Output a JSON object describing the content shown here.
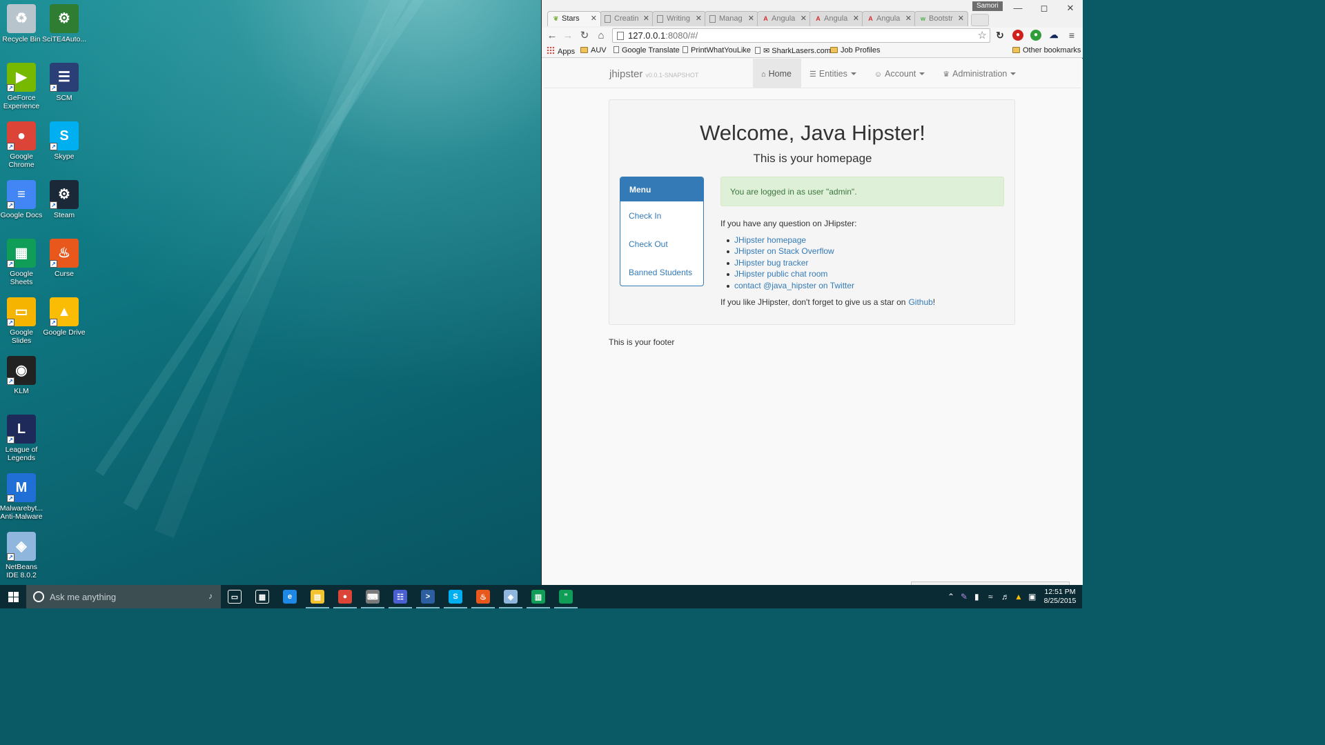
{
  "desktop": {
    "icons": [
      {
        "label": "Recycle Bin",
        "icon": "recycle-bin-icon",
        "color": "#b8c4cc"
      },
      {
        "label": "SciTE4Auto...",
        "icon": "scite-icon",
        "color": "#2e7d32"
      },
      {
        "label": "GeForce Experience",
        "icon": "geforce-icon",
        "color": "#76b900"
      },
      {
        "label": "SCM",
        "icon": "scm-icon",
        "color": "#2a3f75"
      },
      {
        "label": "Google Chrome",
        "icon": "chrome-icon",
        "color": "#db4437"
      },
      {
        "label": "Skype",
        "icon": "skype-icon",
        "color": "#00aff0"
      },
      {
        "label": "Google Docs",
        "icon": "google-docs-icon",
        "color": "#4285f4"
      },
      {
        "label": "Steam",
        "icon": "steam-icon",
        "color": "#1b2838"
      },
      {
        "label": "Google Sheets",
        "icon": "google-sheets-icon",
        "color": "#0f9d58"
      },
      {
        "label": "Curse",
        "icon": "curse-icon",
        "color": "#e8571c"
      },
      {
        "label": "Google Slides",
        "icon": "google-slides-icon",
        "color": "#f4b400"
      },
      {
        "label": "Google Drive",
        "icon": "google-drive-icon",
        "color": "#fbbc05"
      },
      {
        "label": "KLM",
        "icon": "klm-icon",
        "color": "#222222"
      },
      {
        "label": "League of Legends",
        "icon": "league-of-legends-icon",
        "color": "#1e2a5a"
      },
      {
        "label": "Malwarebyt... Anti-Malware",
        "icon": "malwarebytes-icon",
        "color": "#1f6fd6"
      },
      {
        "label": "NetBeans IDE 8.0.2",
        "icon": "netbeans-icon",
        "color": "#8fb6dc"
      }
    ]
  },
  "browser": {
    "profile_name": "Samori",
    "tabs": [
      {
        "label": "Stars",
        "icon": "leaf-icon",
        "active": true
      },
      {
        "label": "Creatin",
        "icon": "page-icon"
      },
      {
        "label": "Writing",
        "icon": "page-icon"
      },
      {
        "label": "Manag",
        "icon": "page-icon"
      },
      {
        "label": "Angula",
        "icon": "angular-icon"
      },
      {
        "label": "Angula",
        "icon": "angular-icon"
      },
      {
        "label": "Angula",
        "icon": "angular-icon"
      },
      {
        "label": "Bootstr",
        "icon": "w3-icon"
      }
    ],
    "url_host": "127.0.0.1",
    "url_rest": ":8080/#/",
    "bookmarks": [
      {
        "label": "Apps",
        "icon": "apps-grid-icon"
      },
      {
        "label": "AUV",
        "icon": "folder-icon"
      },
      {
        "label": "Google Translate",
        "icon": "page-icon"
      },
      {
        "label": "PrintWhatYouLike",
        "icon": "page-icon"
      },
      {
        "label": "✉ SharkLasers.com",
        "icon": "page-icon"
      },
      {
        "label": "Job Profiles",
        "icon": "folder-icon"
      }
    ],
    "other_bookmarks": "Other bookmarks"
  },
  "app": {
    "brand": "jhipster",
    "version": "v0.0.1-SNAPSHOT",
    "nav": [
      {
        "label": "Home",
        "icon": "home-icon",
        "glyph": "⌂"
      },
      {
        "label": "Entities",
        "icon": "list-icon",
        "glyph": "☰"
      },
      {
        "label": "Account",
        "icon": "user-icon",
        "glyph": "☺"
      },
      {
        "label": "Administration",
        "icon": "crown-icon",
        "glyph": "♛"
      }
    ],
    "welcome": "Welcome, Java Hipster!",
    "subtitle": "This is your homepage",
    "menu": {
      "title": "Menu",
      "items": [
        "Check In",
        "Check Out",
        "Banned Students"
      ]
    },
    "alert": "You are logged in as user \"admin\".",
    "question": "If you have any question on JHipster:",
    "links": [
      "JHipster homepage",
      "JHipster on Stack Overflow",
      "JHipster bug tracker",
      "JHipster public chat room",
      "contact @java_hipster on Twitter"
    ],
    "star_text": "If you like JHipster, don't forget to give us a star on",
    "star_link": "Github",
    "star_end": "!",
    "footer": "This is your footer"
  },
  "taskbar": {
    "search_placeholder": "Ask me anything",
    "apps": [
      {
        "name": "task-view-icon",
        "color": "#0a2b33",
        "glyph": "▭"
      },
      {
        "name": "store-icon",
        "color": "#0a2b33",
        "glyph": "▦"
      },
      {
        "name": "edge-icon",
        "color": "#1e88e5",
        "glyph": "e"
      },
      {
        "name": "file-explorer-icon",
        "color": "#f4c430",
        "glyph": "▤"
      },
      {
        "name": "chrome-icon",
        "color": "#db4437",
        "glyph": "●"
      },
      {
        "name": "keyboard-icon",
        "color": "#7a7a7a",
        "glyph": "⌨"
      },
      {
        "name": "network-tool-icon",
        "color": "#4a5fd0",
        "glyph": "☷"
      },
      {
        "name": "powershell-icon",
        "color": "#2d5fa0",
        "glyph": ">"
      },
      {
        "name": "skype-icon",
        "color": "#00aff0",
        "glyph": "S"
      },
      {
        "name": "curse-icon",
        "color": "#e8571c",
        "glyph": "♨"
      },
      {
        "name": "netbeans-icon",
        "color": "#8fb6dc",
        "glyph": "◈"
      },
      {
        "name": "sheets-icon",
        "color": "#0f9d58",
        "glyph": "▥"
      },
      {
        "name": "hangouts-icon",
        "color": "#0f9d58",
        "glyph": "”"
      }
    ],
    "time": "12:51 PM",
    "date": "8/25/2015"
  }
}
